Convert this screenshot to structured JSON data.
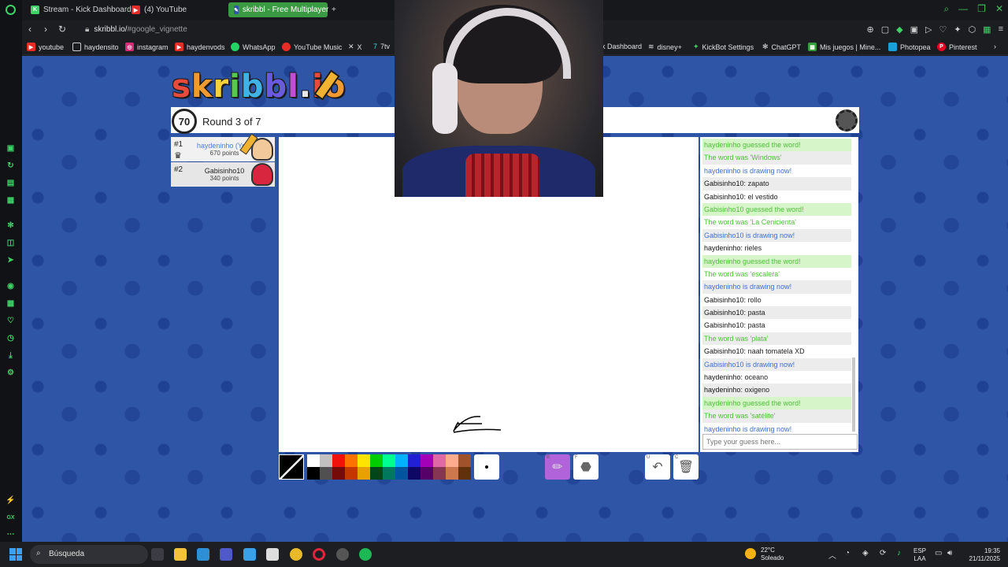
{
  "browser": {
    "tabs": [
      {
        "label": "Stream - Kick Dashboard",
        "icon": "kick-icon",
        "active": false
      },
      {
        "label": "(4) YouTube",
        "icon": "youtube-icon",
        "active": false
      },
      {
        "label": "skribbl - Free Multiplayer",
        "icon": "skribbl-icon",
        "active": true
      }
    ],
    "new_tab": "+",
    "url": "skribbl.io/",
    "url_hash": "#google_vignette",
    "bookmarks": [
      {
        "label": "youtube",
        "icon": "youtube-icon"
      },
      {
        "label": "haydensito",
        "icon": "page-icon"
      },
      {
        "label": "instagram",
        "icon": "instagram-icon"
      },
      {
        "label": "haydenvods",
        "icon": "youtube-icon"
      },
      {
        "label": "WhatsApp",
        "icon": "whatsapp-icon"
      },
      {
        "label": "YouTube Music",
        "icon": "youtube-music-icon"
      },
      {
        "label": "X",
        "icon": "x-icon"
      },
      {
        "label": "7tv",
        "icon": "7tv-icon"
      },
      {
        "label": "k Dashboard",
        "icon": "kick-icon"
      },
      {
        "label": "disney+",
        "icon": "disney-icon"
      },
      {
        "label": "KickBot Settings",
        "icon": "kickbot-icon"
      },
      {
        "label": "ChatGPT",
        "icon": "chatgpt-icon"
      },
      {
        "label": "Mis juegos | Mine...",
        "icon": "minecraft-icon"
      },
      {
        "label": "Photopea",
        "icon": "photopea-icon"
      },
      {
        "label": "Pinterest",
        "icon": "pinterest-icon"
      }
    ]
  },
  "game": {
    "logo_text": "skribbl.io",
    "timer": "70",
    "round": "Round 3 of 7",
    "players": [
      {
        "rank": "#1",
        "name": "haydeninho (You)",
        "points": "670 points",
        "is_me": true
      },
      {
        "rank": "#2",
        "name": "Gabisinho10",
        "points": "340 points",
        "is_me": false
      }
    ],
    "chat": [
      {
        "type": "guess",
        "text": "haydeninho guessed the word!"
      },
      {
        "type": "word",
        "text": "The word was 'Windows'"
      },
      {
        "type": "draw",
        "text": "haydeninho is drawing now!"
      },
      {
        "type": "msg",
        "user": "Gabisinho10:",
        "text": "zapato"
      },
      {
        "type": "msg",
        "user": "Gabisinho10:",
        "text": "el vestido"
      },
      {
        "type": "guess",
        "text": "Gabisinho10 guessed the word!"
      },
      {
        "type": "word",
        "text": "The word was 'La Cenicienta'"
      },
      {
        "type": "draw",
        "text": "Gabisinho10 is drawing now!"
      },
      {
        "type": "msg",
        "user": "haydeninho:",
        "text": "rieles"
      },
      {
        "type": "guess",
        "text": "haydeninho guessed the word!"
      },
      {
        "type": "word",
        "text": "The word was 'escalera'"
      },
      {
        "type": "draw",
        "text": "haydeninho is drawing now!"
      },
      {
        "type": "msg",
        "user": "Gabisinho10:",
        "text": "rollo"
      },
      {
        "type": "msg",
        "user": "Gabisinho10:",
        "text": "pasta"
      },
      {
        "type": "msg",
        "user": "Gabisinho10:",
        "text": "pasta"
      },
      {
        "type": "word",
        "text": "The word was 'plata'"
      },
      {
        "type": "msg",
        "user": "Gabisinho10:",
        "text": "naah tomatela XD"
      },
      {
        "type": "draw",
        "text": "Gabisinho10 is drawing now!"
      },
      {
        "type": "msg",
        "user": "haydeninho:",
        "text": "oceano"
      },
      {
        "type": "msg",
        "user": "haydeninho:",
        "text": "oxigeno"
      },
      {
        "type": "guess",
        "text": "haydeninho guessed the word!"
      },
      {
        "type": "word",
        "text": "The word was 'satélite'"
      },
      {
        "type": "draw",
        "text": "haydeninho is drawing now!"
      }
    ],
    "guess_placeholder": "Type your guess here...",
    "palette": [
      "#ffffff",
      "#c1c1c1",
      "#ef130b",
      "#ff7100",
      "#ffe400",
      "#00cc00",
      "#00ff91",
      "#00b2ff",
      "#231fd3",
      "#a300ba",
      "#df69a7",
      "#ffac8e",
      "#a0522d",
      "#000000",
      "#505050",
      "#740b07",
      "#c23800",
      "#e8a200",
      "#004619",
      "#00785d",
      "#00569e",
      "#0e0865",
      "#550069",
      "#873554",
      "#cc774d",
      "#63300d"
    ],
    "tools": {
      "brush_key": "B",
      "fill_key": "F",
      "undo_key": "U",
      "clear_key": "C"
    }
  },
  "taskbar": {
    "search_label": "Búsqueda",
    "weather_temp": "22°C",
    "weather_desc": "Soleado",
    "lang_1": "ESP",
    "lang_2": "LAA",
    "time": "19:35",
    "date": "21/11/2025"
  }
}
